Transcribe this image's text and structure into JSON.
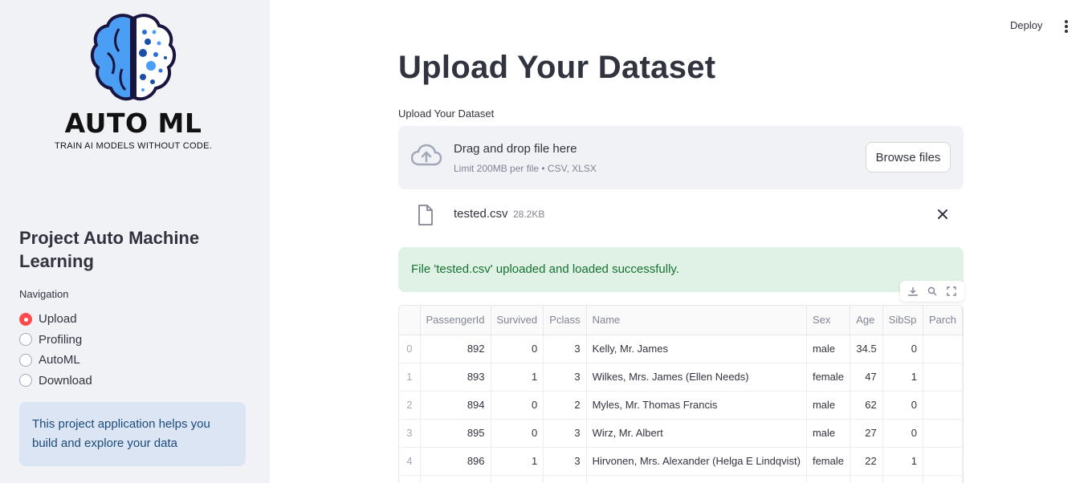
{
  "sidebar": {
    "logo": {
      "title": "AUTO ML",
      "subtitle": "TRAIN AI MODELS WITHOUT CODE."
    },
    "project_title": "Project Auto Machine Learning",
    "nav_label": "Navigation",
    "nav_items": [
      {
        "label": "Upload",
        "selected": true
      },
      {
        "label": "Profiling",
        "selected": false
      },
      {
        "label": "AutoML",
        "selected": false
      },
      {
        "label": "Download",
        "selected": false
      }
    ],
    "info_text": "This project application helps you build and explore your data"
  },
  "header": {
    "deploy_label": "Deploy",
    "menu_icon": "kebab-menu-icon"
  },
  "main": {
    "title": "Upload Your Dataset",
    "uploader": {
      "label": "Upload Your Dataset",
      "drop_title": "Drag and drop file here",
      "drop_limit": "Limit 200MB per file • CSV, XLSX",
      "browse_label": "Browse files"
    },
    "file": {
      "name": "tested.csv",
      "size": "28.2KB"
    },
    "success_message": "File 'tested.csv' uploaded and loaded successfully.",
    "table": {
      "columns": [
        "",
        "PassengerId",
        "Survived",
        "Pclass",
        "Name",
        "Sex",
        "Age",
        "SibSp",
        "Parch"
      ],
      "rows": [
        [
          "0",
          "892",
          "0",
          "3",
          "Kelly, Mr. James",
          "male",
          "34.5",
          "0",
          ""
        ],
        [
          "1",
          "893",
          "1",
          "3",
          "Wilkes, Mrs. James (Ellen Needs)",
          "female",
          "47",
          "1",
          ""
        ],
        [
          "2",
          "894",
          "0",
          "2",
          "Myles, Mr. Thomas Francis",
          "male",
          "62",
          "0",
          ""
        ],
        [
          "3",
          "895",
          "0",
          "3",
          "Wirz, Mr. Albert",
          "male",
          "27",
          "0",
          ""
        ],
        [
          "4",
          "896",
          "1",
          "3",
          "Hirvonen, Mrs. Alexander (Helga E Lindqvist)",
          "female",
          "22",
          "1",
          ""
        ],
        [
          "",
          "",
          "",
          "",
          "",
          "",
          "",
          "",
          ""
        ]
      ]
    }
  },
  "colors": {
    "accent": "#ff4b4b",
    "sidebar_bg": "#f0f2f6",
    "info_bg": "#dbe5f3",
    "success_bg": "#dff2e5",
    "success_text": "#177233"
  }
}
